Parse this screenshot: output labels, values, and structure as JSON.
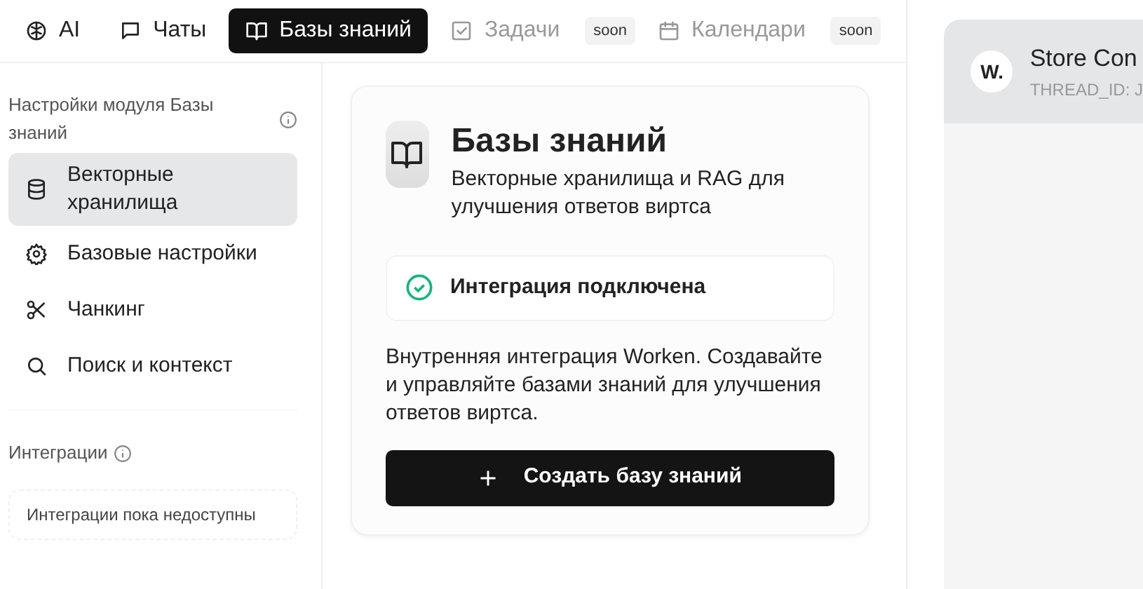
{
  "tabs": [
    {
      "label": "AI",
      "selected": false,
      "disabled": false
    },
    {
      "label": "Чаты",
      "selected": false,
      "disabled": false
    },
    {
      "label": "Базы знаний",
      "selected": true,
      "disabled": false
    },
    {
      "label": "Задачи",
      "selected": false,
      "disabled": true,
      "badge": "soon"
    },
    {
      "label": "Календари",
      "selected": false,
      "disabled": true,
      "badge": "soon"
    }
  ],
  "sidebar": {
    "title": "Настройки модуля Базы знаний",
    "items": [
      {
        "label": "Векторные хранилища",
        "selected": true
      },
      {
        "label": "Базовые настройки",
        "selected": false
      },
      {
        "label": "Чанкинг",
        "selected": false
      },
      {
        "label": "Поиск и контекст",
        "selected": false
      }
    ],
    "integrations_title": "Интеграции",
    "integrations_empty": "Интеграции пока недоступны"
  },
  "card": {
    "title": "Базы знаний",
    "subtitle": "Векторные хранилища и RAG для улучшения ответов виртса",
    "status": "Интеграция подключена",
    "connected": true,
    "description": "Внутренняя интеграция Worken. Создавайте и управляйте базами знаний для улучшения ответов виртса.",
    "button": "Создать базу знаний"
  },
  "preview": {
    "avatar": "W.",
    "title": "Store Con",
    "thread": "THREAD_ID: J"
  }
}
